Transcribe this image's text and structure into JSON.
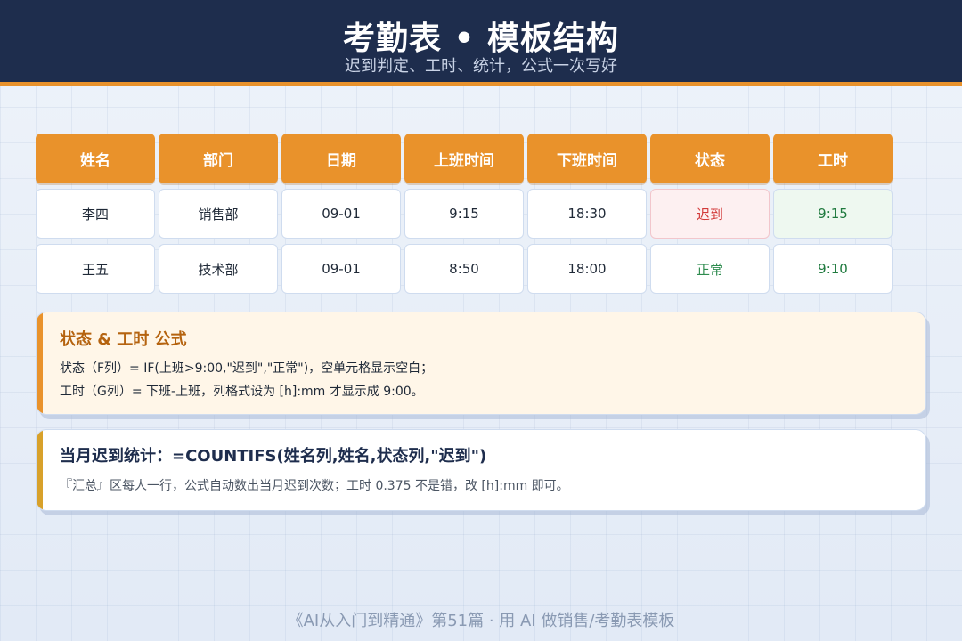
{
  "header": {
    "title": "考勤表 • 模板结构",
    "subtitle": "迟到判定、工时、统计，公式一次写好"
  },
  "table": {
    "columns": [
      "姓名",
      "部门",
      "日期",
      "上班时间",
      "下班时间",
      "状态",
      "工时"
    ],
    "rows": [
      [
        "李四",
        "销售部",
        "09-01",
        "9:15",
        "18:30",
        "迟到",
        "9:15"
      ],
      [
        "王五",
        "技术部",
        "09-01",
        "8:50",
        "18:00",
        "正常",
        "9:10"
      ]
    ]
  },
  "formula_card": {
    "title": "状态 & 工时 公式",
    "line1": "状态（F列）= IF(上班>9:00,\"迟到\",\"正常\")，空单元格显示空白；",
    "line2": "工时（G列）= 下班-上班，列格式设为 [h]:mm 才显示成 9:00。"
  },
  "stats_card": {
    "title": "当月迟到统计：=COUNTIFS(姓名列,姓名,状态列,\"迟到\")",
    "line1": "『汇总』区每人一行，公式自动数出当月迟到次数；工时 0.375 不是错，改 [h]:mm 即可。"
  },
  "footer": {
    "text": "《AI从入门到精通》第51篇 · 用 AI 做销售/考勤表模板"
  },
  "colors": {
    "header_bg": "#1e2d4d",
    "accent_orange": "#e9922b",
    "late_red": "#d23a3a",
    "ok_green": "#2e8b4e"
  }
}
